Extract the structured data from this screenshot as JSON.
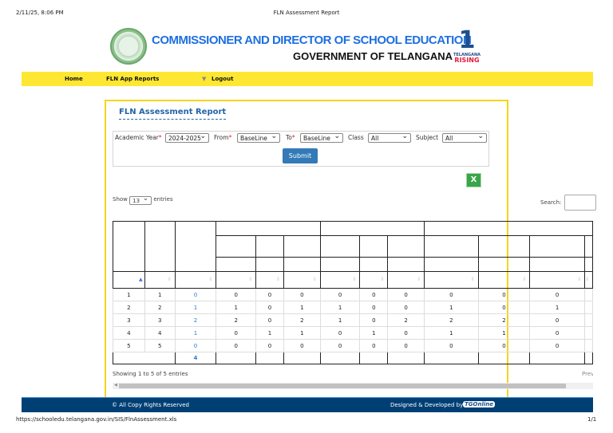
{
  "print_header": {
    "date": "2/11/25, 8:06 PM",
    "title": "FLN Assessment Report"
  },
  "header": {
    "org_line1": "COMMISSIONER AND DIRECTOR OF SCHOOL EDUCATION",
    "org_line2": "GOVERNMENT OF TELANGANA",
    "logo_text_top": "TELANGANA",
    "logo_text_bottom": "RISING"
  },
  "nav": {
    "items": [
      "Home",
      "FLN App Reports",
      "Logout"
    ]
  },
  "report": {
    "title": "FLN Assessment Report"
  },
  "filters": {
    "academic_year_label": "Academic Year",
    "academic_year": "2024-2025",
    "from_label": "From",
    "from": "BaseLine",
    "to_label": "To",
    "to": "BaseLine",
    "class_label": "Class",
    "class": "All",
    "subject_label": "Subject",
    "subject": "All",
    "required_mark": "*",
    "submit": "Submit"
  },
  "table_controls": {
    "show_label": "Show",
    "page_size": "13",
    "entries_label": "entries",
    "search_label": "Search:"
  },
  "table": {
    "rows": [
      [
        "1",
        "1",
        "0",
        "0",
        "0",
        "0",
        "0",
        "0",
        "0",
        "0",
        "0",
        "0"
      ],
      [
        "2",
        "2",
        "1",
        "1",
        "0",
        "1",
        "1",
        "0",
        "0",
        "1",
        "0",
        "1"
      ],
      [
        "3",
        "3",
        "2",
        "2",
        "0",
        "2",
        "1",
        "0",
        "2",
        "2",
        "2",
        "0"
      ],
      [
        "4",
        "4",
        "1",
        "0",
        "1",
        "1",
        "0",
        "1",
        "0",
        "1",
        "1",
        "0"
      ],
      [
        "5",
        "5",
        "0",
        "0",
        "0",
        "0",
        "0",
        "0",
        "0",
        "0",
        "0",
        "0"
      ]
    ],
    "footer_total": "4"
  },
  "pagination": {
    "info": "Showing 1 to 5 of 5 entries",
    "prev": "Previous"
  },
  "footer": {
    "copyright": "© All Copy Rights Reserved",
    "designed_by": "Designed & Developed by",
    "brand": "TGOnline"
  },
  "print_footer": {
    "url": "https://schooledu.telangana.gov.in/SIS/FlnAssessment.xls",
    "page": "1/1"
  }
}
